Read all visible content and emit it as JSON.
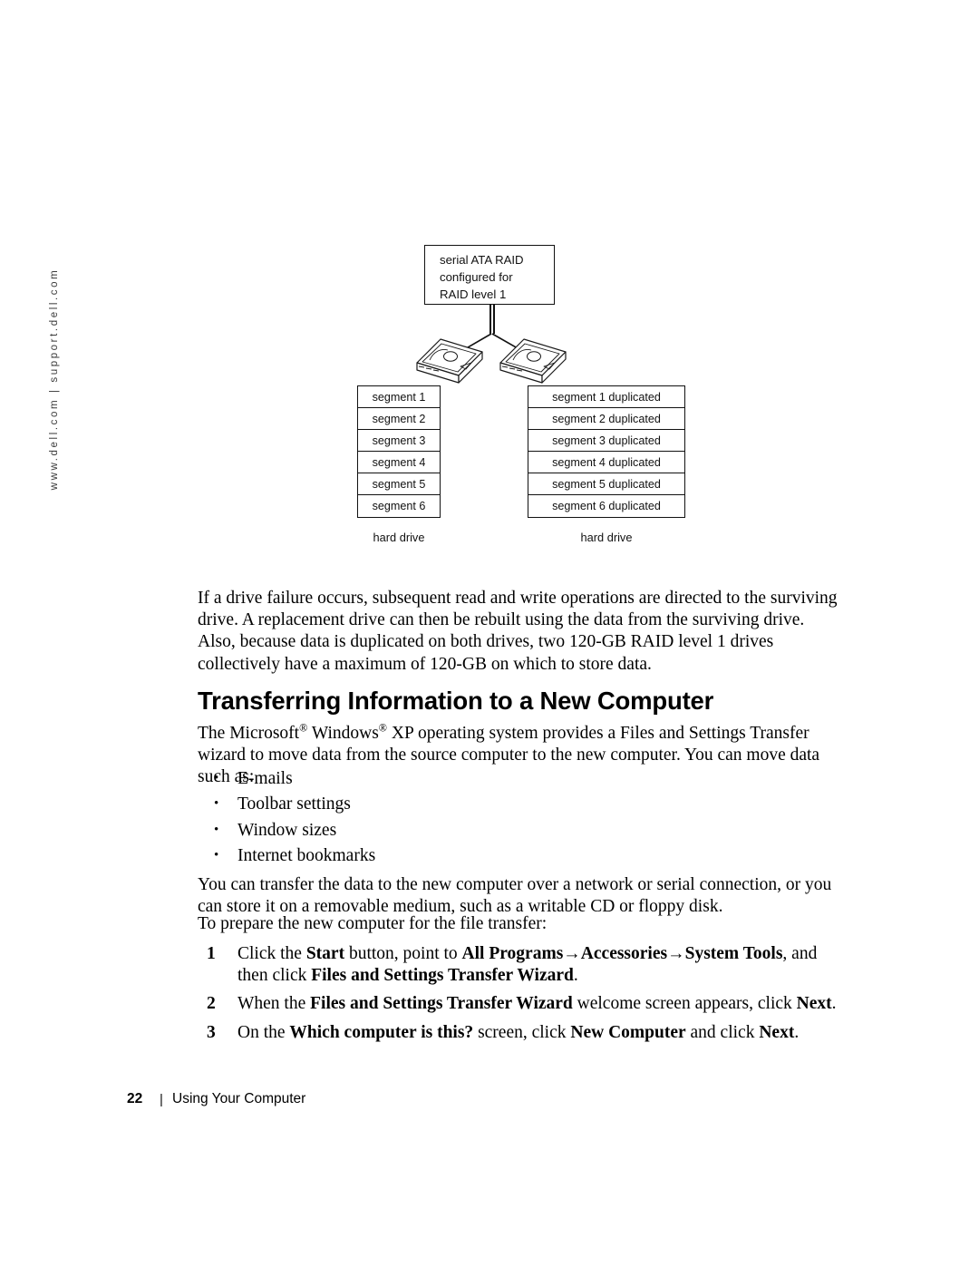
{
  "sidebar": {
    "url_rail": "www.dell.com | support.dell.com"
  },
  "figure": {
    "title_lines": [
      "serial ATA RAID",
      "configured for",
      "RAID level 1"
    ],
    "left_drive_icon": "hard-drive-icon",
    "right_drive_icon": "hard-drive-icon",
    "left_table": [
      "segment 1",
      "segment 2",
      "segment 3",
      "segment 4",
      "segment 5",
      "segment 6"
    ],
    "right_table": [
      "segment 1 duplicated",
      "segment 2 duplicated",
      "segment 3 duplicated",
      "segment 4 duplicated",
      "segment 5 duplicated",
      "segment 6 duplicated"
    ],
    "left_caption": "hard drive",
    "right_caption": "hard drive"
  },
  "main": {
    "intro_paragraph": "If a drive failure occurs, subsequent read and write operations are directed to the surviving drive. A replacement drive can then be rebuilt using the data from the surviving drive. Also, because data is duplicated on both drives, two 120-GB RAID level 1 drives collectively have a maximum of 120-GB on which to store data.",
    "section_title": "Transferring Information to a New Computer",
    "bullets": [
      "E-mails",
      "Toolbar settings",
      "Window sizes",
      "Internet bookmarks"
    ],
    "transfer_paragraph": "You can transfer the data to the new computer over a network or serial connection, or you can store it on a removable medium, such as a writable CD or floppy disk.",
    "prepare_paragraph": "To prepare the new computer for the file transfer:",
    "steps": [
      {
        "num": "1"
      },
      {
        "num": "2"
      },
      {
        "num": "3"
      }
    ],
    "step1": {
      "t1": "Click the ",
      "b1": "Start",
      "t2": " button, point to ",
      "b2": "All Programs",
      "arrow1": "→",
      "b3": "Accessories",
      "arrow2": "→",
      "b4": "System Tools",
      "t3": ", and then click ",
      "b5": "Files and Settings Transfer Wizard",
      "t4": "."
    },
    "step2": {
      "t1": "When the ",
      "b1": "Files and Settings Transfer Wizard",
      "t2": " welcome screen appears, click ",
      "b2": "Next",
      "t3": "."
    },
    "step3": {
      "t1": "On the ",
      "b1": "Which computer is this?",
      "t2": " screen, click ",
      "b2": "New Computer",
      "t3": " and click ",
      "b3": "Next",
      "t4": "."
    },
    "ms_line": {
      "t1": "The Microsoft",
      "sup1": "®",
      "t2": " Windows",
      "sup2": "®",
      "t3": " XP operating system provides a Files and Settings Transfer wizard to move data from the source computer to the new computer. You can move data such as:"
    }
  },
  "footer": {
    "page_number": "22",
    "separator": "|",
    "chapter": "Using Your Computer"
  },
  "colors": {
    "text": "#000000",
    "rule": "#111111",
    "rail_text": "#3a3a3a"
  }
}
